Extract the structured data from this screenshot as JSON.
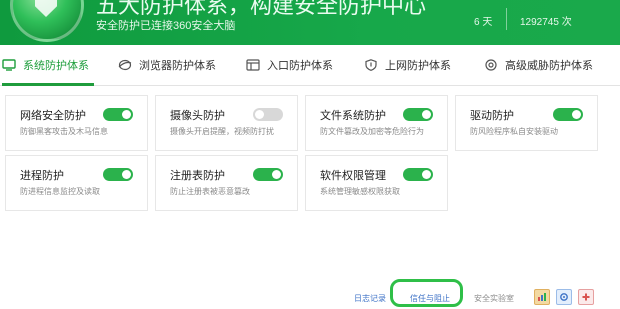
{
  "header": {
    "headline": "五大防护体系，构建安全防护中心",
    "subtitle": "安全防护已连接360安全大脑",
    "days": "6 天",
    "count": "1292745 次"
  },
  "tabs": [
    {
      "label": "系统防护体系",
      "icon": "monitor-icon",
      "active": true
    },
    {
      "label": "浏览器防护体系",
      "icon": "browser-icon",
      "active": false
    },
    {
      "label": "入口防护体系",
      "icon": "entrance-icon",
      "active": false
    },
    {
      "label": "上网防护体系",
      "icon": "shield-icon",
      "active": false
    },
    {
      "label": "高级威胁防护体系",
      "icon": "target-icon",
      "active": false
    }
  ],
  "cards": [
    {
      "title": "网络安全防护",
      "desc": "防御黑客攻击及木马信息",
      "on": true
    },
    {
      "title": "摄像头防护",
      "desc": "摄像头开启提醒，视频防打扰",
      "on": false
    },
    {
      "title": "文件系统防护",
      "desc": "防文件篡改及加密等危险行为",
      "on": true
    },
    {
      "title": "驱动防护",
      "desc": "防风险程序私自安装驱动",
      "on": true
    },
    {
      "title": "进程防护",
      "desc": "防进程信息监控及读取",
      "on": true
    },
    {
      "title": "注册表防护",
      "desc": "防止注册表被恶意篡改",
      "on": true
    },
    {
      "title": "软件权限管理",
      "desc": "系统管理敏感权限获取",
      "on": true
    }
  ],
  "footer": {
    "log_link": "日志记录",
    "trust_link": "信任与阻止",
    "lab_link": "安全实验室",
    "icons": [
      "chart-icon",
      "settings-icon",
      "medical-icon"
    ]
  },
  "colors": {
    "brand_green": "#1aa94b",
    "toggle_on": "#2bb24c",
    "toggle_off": "#d8d8d8",
    "link_blue": "#3f73c7"
  }
}
